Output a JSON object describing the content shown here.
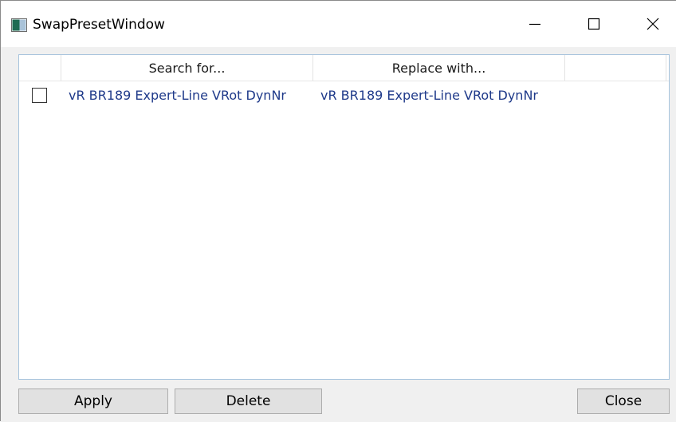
{
  "window": {
    "title": "SwapPresetWindow"
  },
  "titlebar": {
    "minimize_icon": "minimize-icon",
    "maximize_icon": "maximize-icon",
    "close_icon": "close-icon"
  },
  "grid": {
    "columns": [
      "",
      "Search for...",
      "Replace with...",
      ""
    ],
    "rows": [
      {
        "checked": false,
        "search_for": "vR BR189 Expert-Line VRot DynNr",
        "replace_with": "vR BR189 Expert-Line VRot DynNr"
      }
    ]
  },
  "buttons": {
    "apply": "Apply",
    "delete": "Delete",
    "close": "Close"
  },
  "colors": {
    "cell_text": "#1f3a8a",
    "grid_border": "#a6c3dd",
    "button_bg": "#e1e1e1"
  }
}
